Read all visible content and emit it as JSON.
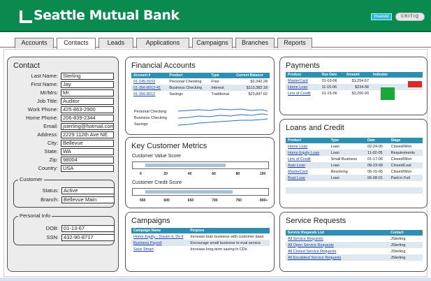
{
  "header": {
    "bank_name": "Seattle Mutual Bank",
    "partner_badge_1": "PowerAd",
    "partner_badge_2": "CRITIQ"
  },
  "tabs": [
    "Accounts",
    "Contacts",
    "Leads",
    "Applications",
    "Campaigns",
    "Branches",
    "Reports"
  ],
  "active_tab": "Contacts",
  "contact": {
    "title": "Contact",
    "fields": [
      {
        "label": "Last Name:",
        "value": "Sterling"
      },
      {
        "label": "First Name:",
        "value": "Jay"
      },
      {
        "label": "Mr/Mrs:",
        "value": "Mr."
      },
      {
        "label": "Job Title:",
        "value": "Auditor"
      },
      {
        "label": "Work Phone:",
        "value": "425-863-2900"
      },
      {
        "label": "Home Phone:",
        "value": "206-839-2344"
      },
      {
        "label": "Email:",
        "value": "jsterling@hotmail.com"
      },
      {
        "label": "Address:",
        "value": "2229 112th Ave NE"
      },
      {
        "label": "City:",
        "value": "Bellevue"
      },
      {
        "label": "State:",
        "value": "WA"
      },
      {
        "label": "Zip:",
        "value": "98004"
      },
      {
        "label": "Country:",
        "value": "USA"
      }
    ],
    "customer_group": {
      "title": "Customer",
      "fields": [
        {
          "label": "Status:",
          "value": "Active"
        },
        {
          "label": "Branch:",
          "value": "Bellevue Main"
        }
      ]
    },
    "personal_group": {
      "title": "Personal Info",
      "fields": [
        {
          "label": "DOB:",
          "value": "01-13-67"
        },
        {
          "label": "SSN:",
          "value": "432-90-8717"
        }
      ]
    }
  },
  "financial": {
    "title": "Financial Accounts",
    "columns": [
      "Account #",
      "Product",
      "Type",
      "Current Balance"
    ],
    "rows": [
      [
        "01-145-9102",
        "Personal Checking",
        "Free",
        "$2,342.28"
      ],
      [
        "01-356-8012-41",
        "Business Checking",
        "Interest",
        "$113,382.18"
      ],
      [
        "01-356-8012",
        "Savings",
        "Traditional",
        "$23,897.02"
      ]
    ],
    "trend_labels": [
      "Personal Checking",
      "Business Checking",
      "Savings"
    ],
    "trend_color": "#2e6fb0"
  },
  "metrics": {
    "title": "Key Customer Metrics",
    "value_score": {
      "label": "Customer Value Score",
      "ticks": [
        "0",
        "20",
        "40",
        "60",
        "80",
        "100"
      ],
      "fill_fraction": 0.72
    },
    "credit_score": {
      "label": "Customer Credit Score",
      "ticks": [
        "550",
        "600",
        "650",
        "700",
        "750",
        "800+"
      ],
      "fill_fraction": 0.78
    }
  },
  "campaigns": {
    "title": "Campaigns",
    "columns": [
      "Campaign Name",
      "Purpose"
    ],
    "rows": [
      [
        "Home Equity - Dream it, Do it",
        "Increase loan business with customer base"
      ],
      [
        "Business Payroll",
        "Encourage small business to eval service"
      ],
      [
        "Save Smart",
        "Increase long-term saving in CDs"
      ]
    ]
  },
  "payments": {
    "title": "Payments",
    "columns": [
      "Product",
      "Due Date",
      "Amount",
      "Indicator"
    ],
    "rows": [
      [
        "MasterCard",
        "01-03-06",
        "$1,254.67"
      ],
      [
        "Home Loan",
        "11-15-06",
        "$234.58"
      ],
      [
        "Line of Credit",
        "01-15-06",
        "$3,200.00"
      ]
    ],
    "indicator_colors": [
      "#d92b2b",
      "#1aa83a",
      "#1aa83a"
    ]
  },
  "loans": {
    "title": "Loans and Credit",
    "columns": [
      "Product",
      "Type",
      "Date",
      "Stage"
    ],
    "rows": [
      [
        "Home Loan",
        "Loan",
        "02-24-00",
        "Closed/Won"
      ],
      [
        "Home Equity Loan",
        "Loan",
        "11-02-05",
        "Requirements"
      ],
      [
        "Line of Credit",
        "Small Business",
        "01-17-06",
        "Closed/Won"
      ],
      [
        "Auto Loan",
        "Loan",
        "09-23-99",
        "Closed/Lost"
      ],
      [
        "MasterCard",
        "Revolving",
        "05-15-05",
        "Closed/Won"
      ],
      [
        "Boat Loan",
        "Loan",
        "06-08-01",
        "Paid in Full"
      ]
    ]
  },
  "service": {
    "title": "Service Requests",
    "columns": [
      "Service Requests List",
      "Contact"
    ],
    "rows": [
      [
        "All Service Requests",
        "JSterling"
      ],
      [
        "All Open Service Requests",
        "JSterling"
      ],
      [
        "All Closed Service Requests",
        "JSterling"
      ],
      [
        "All Escalated Service Requests",
        "JSterling"
      ]
    ]
  }
}
